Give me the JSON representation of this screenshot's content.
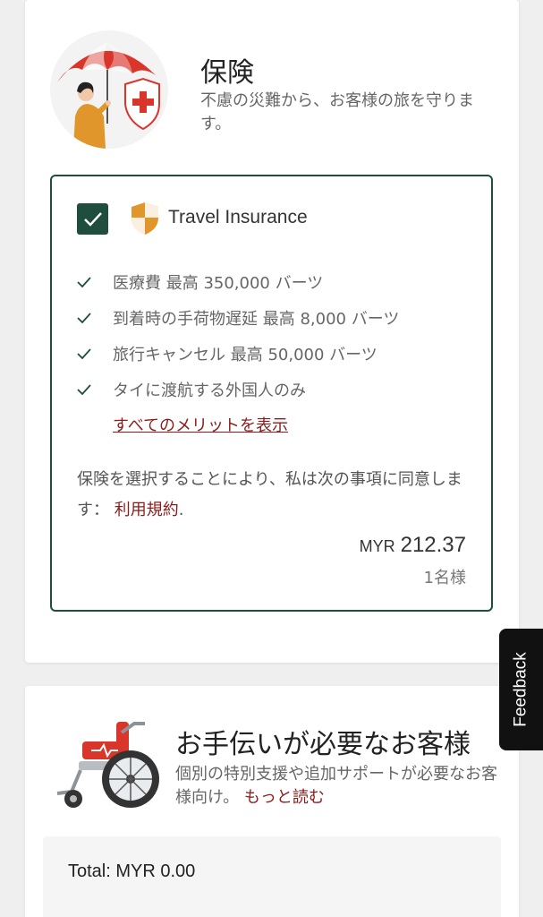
{
  "insurance": {
    "title": "保険",
    "description": "不慮の災難から、お客様の旅を守ります。",
    "option": {
      "checked": true,
      "name": "Travel Insurance",
      "benefits": [
        "医療費 最高 350,000 バーツ",
        "到着時の手荷物遅延 最高 8,000 バーツ",
        "旅行キャンセル 最高 50,000 バーツ",
        "タイに渡航する外国人のみ"
      ],
      "see_all_label": "すべてのメリットを表示",
      "consent_text": "保険を選択することにより、私は次の事項に同意します：",
      "terms_label": "利用規約",
      "consent_suffix": ".",
      "currency": "MYR",
      "amount": "212.37",
      "pax_label": "1名様"
    }
  },
  "assistance": {
    "title": "お手伝いが必要なお客様",
    "description": "個別の特別支援や追加サポートが必要なお客様向け。",
    "read_more_label": "もっと読む",
    "total_label": "Total:  MYR 0.00"
  },
  "feedback_label": "Feedback",
  "colors": {
    "accent_green": "#1f4d3e",
    "link_red": "#8b1c1c",
    "shield_orange": "#e0962a",
    "umbrella_red": "#d9352b"
  },
  "icons": {
    "checkbox": "check-icon",
    "benefit": "check-icon",
    "option": "shield-icon"
  }
}
